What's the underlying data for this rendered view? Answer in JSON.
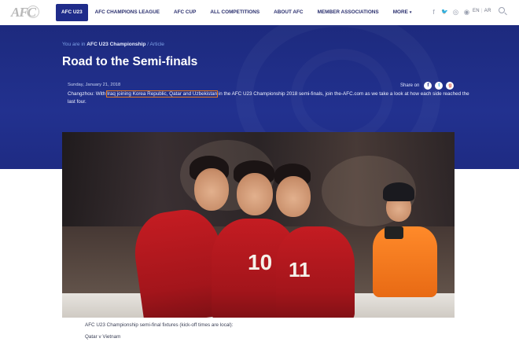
{
  "nav": {
    "logo_text": "AFC",
    "items": [
      {
        "label": "AFC U23",
        "active": true
      },
      {
        "label": "AFC CHAMPIONS LEAGUE",
        "active": false
      },
      {
        "label": "AFC CUP",
        "active": false
      },
      {
        "label": "ALL COMPETITIONS",
        "active": false
      },
      {
        "label": "ABOUT AFC",
        "active": false
      },
      {
        "label": "MEMBER ASSOCIATIONS",
        "active": false
      },
      {
        "label": "MORE",
        "active": false
      }
    ],
    "more_caret": "▾",
    "social_icons": [
      "facebook-icon",
      "twitter-icon",
      "instagram-icon",
      "weibo-icon"
    ],
    "social_glyphs": [
      "f",
      "🐦",
      "◎",
      "◉"
    ],
    "lang_en": "EN",
    "lang_sep": "|",
    "lang_ar": "AR"
  },
  "article": {
    "breadcrumb_prefix": "You are in",
    "breadcrumb_section": "AFC U23 Championship",
    "breadcrumb_suffix": "/ Article",
    "title": "Road to the Semi-finals",
    "date": "Sunday, January 21, 2018",
    "lead_before": "Changzhou: With ",
    "lead_highlight": "Iraq joining Korea Republic, Qatar and Uzbekistan",
    "lead_after": " in the AFC U23 Championship 2018 semi-finals, join the-AFC.com as we take a look at how each side reached the last four.",
    "share_label": "Share on"
  },
  "photo": {
    "jersey_numbers": [
      "10",
      "11"
    ]
  },
  "body": {
    "fixtures_heading": "AFC U23 Championship semi-final fixtures (kick-off times are local):",
    "first_match": "Qatar v Vietnam"
  },
  "colors": {
    "brand_navy": "#1f2c8a",
    "highlight_outline": "#e87a1e",
    "jersey_red": "#c41c22"
  }
}
